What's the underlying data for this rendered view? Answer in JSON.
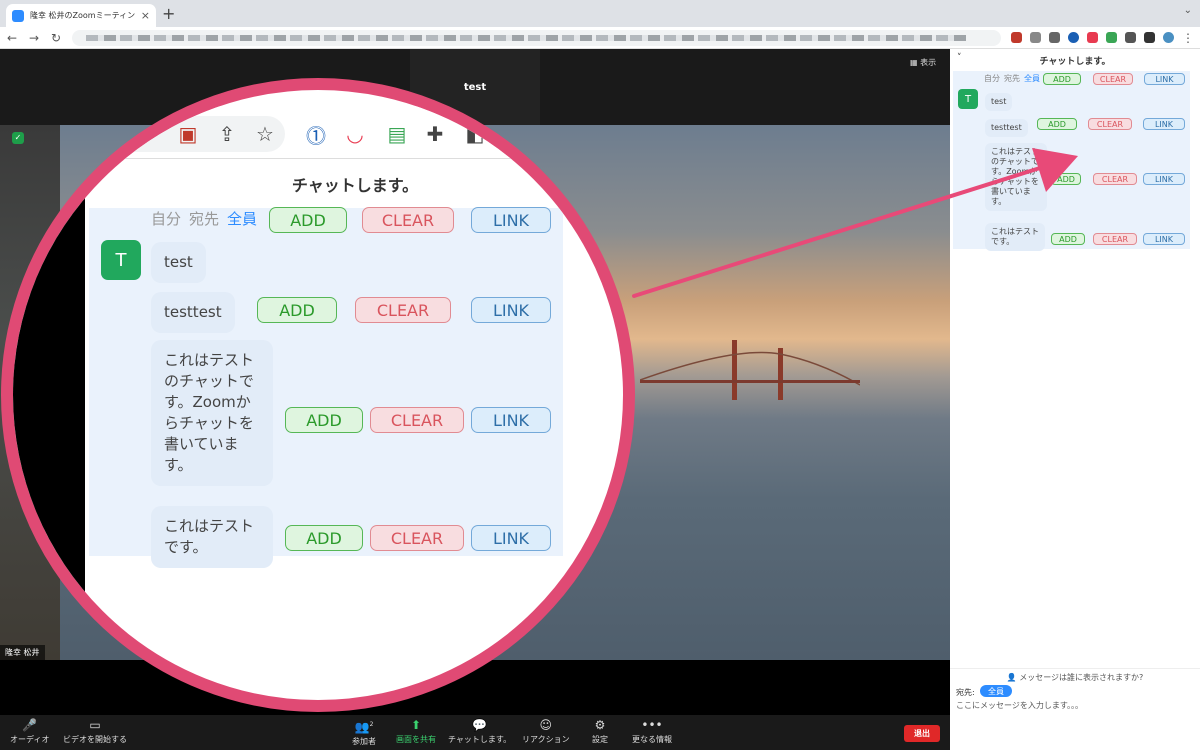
{
  "browser": {
    "tab_title": "隆幸 松井のZoomミーティング",
    "tab_close": "×",
    "new_tab": "+",
    "window_control": "⌄"
  },
  "zoom": {
    "speaker_name": "test",
    "view_button": "表示",
    "participant_name": "隆幸 松井",
    "participant_count": "2",
    "controls": {
      "audio": "オーディオ",
      "video": "ビデオを開始する",
      "participants": "参加者",
      "share": "画面を共有",
      "chat": "チャットします。",
      "reactions": "リアクション",
      "settings": "設定",
      "more": "更なる情報",
      "leave": "退出"
    }
  },
  "chat": {
    "title": "チャットします。",
    "target_self": "自分",
    "target_to": "宛先",
    "target_all": "全員",
    "avatar_initial": "T",
    "btn_add": "ADD",
    "btn_clear": "CLEAR",
    "btn_link": "LINK",
    "messages": [
      {
        "text": "test"
      },
      {
        "text": "testtest"
      },
      {
        "text": "これはテストのチャットです。Zoomからチャットを書いています。"
      },
      {
        "text": "これはテストです。"
      }
    ],
    "visibility_note": "メッセージは誰に表示されますか?",
    "to_label": "宛先:",
    "to_value": "全員",
    "input_placeholder": "ここにメッセージを入力します。。。"
  },
  "colors": {
    "accent": "#2d8cff",
    "avatar": "#21a85d",
    "magnifier_ring": "#e04a74",
    "arrow": "#e84a78",
    "leave": "#e02828"
  }
}
